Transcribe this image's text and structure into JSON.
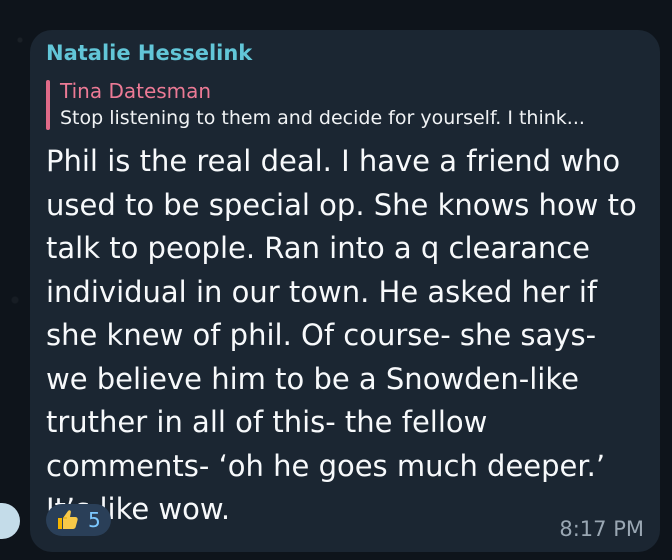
{
  "message": {
    "sender_name": "Natalie Hesselink",
    "reply": {
      "author": "Tina Datesman",
      "snippet": "Stop listening to them and decide for yourself. I think..."
    },
    "body": "Phil is the real deal. I have a friend who used to be special op. She knows how to talk to people. Ran into a q clearance individual in our town. He asked her if she knew of phil. Of course- she says- we believe him to be a Snowden-like truther in all of this- the fellow comments- ‘oh he goes much deeper.’ It’s like wow.",
    "reaction": {
      "icon": "thumbs-up-icon",
      "count": "5"
    },
    "timestamp": "8:17 PM"
  },
  "colors": {
    "background": "#0e141b",
    "bubble": "#1b2632",
    "sender": "#62c6d8",
    "reply_accent": "#e06a88",
    "reply_author": "#ec7a95",
    "reaction_bg": "#2a3f58",
    "reaction_count": "#7cc8ff",
    "timestamp": "#9aa7b3"
  }
}
